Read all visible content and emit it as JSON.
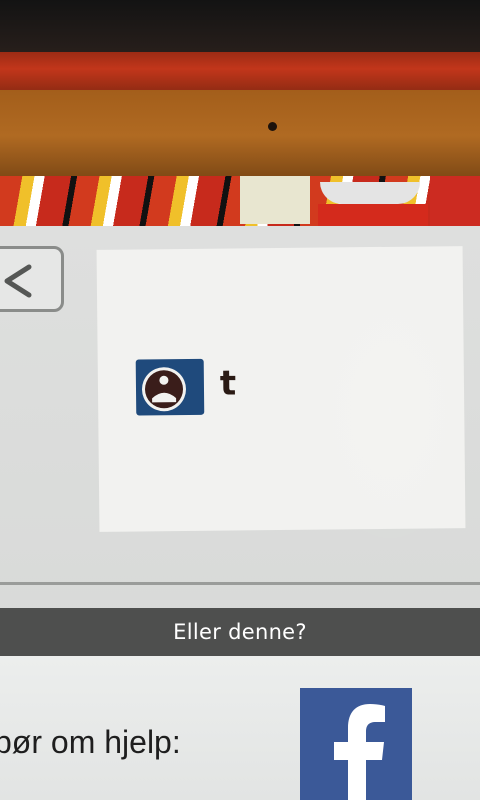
{
  "navigation": {
    "back_icon": "chevron-left-icon"
  },
  "logo": {
    "icon": "info-person-icon",
    "suffix": "t"
  },
  "caption": {
    "text": "Eller denne?"
  },
  "help": {
    "text": "pør om hjelp:"
  },
  "facebook": {
    "icon": "facebook-icon",
    "brand_color": "#3b5998"
  },
  "colors": {
    "caption_background": "#303030",
    "logo_blue": "#1f4a7c"
  }
}
